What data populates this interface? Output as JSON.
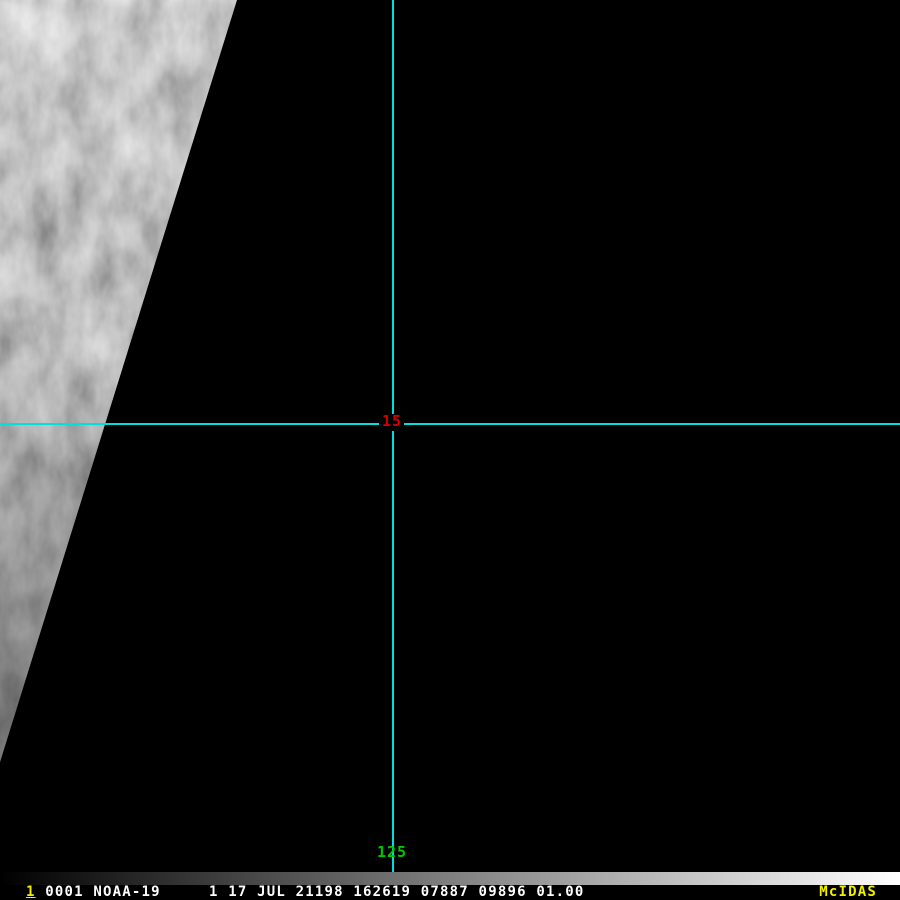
{
  "display": {
    "background_color": "#000000",
    "satellite_swath_name": "satellite-image-swath"
  },
  "crosshair": {
    "color": "#00dede",
    "cursor_label": "15",
    "cursor_label_color": "#d40000"
  },
  "image_line_label": {
    "text": "125",
    "color": "#00c800"
  },
  "colorbar": {
    "start_color": "#000000",
    "end_color": "#ffffff"
  },
  "status_bar": {
    "frame_number": "1",
    "frame_color": "#f0f000",
    "info_text": " 0001 NOAA-19     1 17 JUL 21198 162619 07887 09896 01.00",
    "info_color": "#ffffff",
    "brand": "McIDAS",
    "brand_color": "#f0f000"
  }
}
